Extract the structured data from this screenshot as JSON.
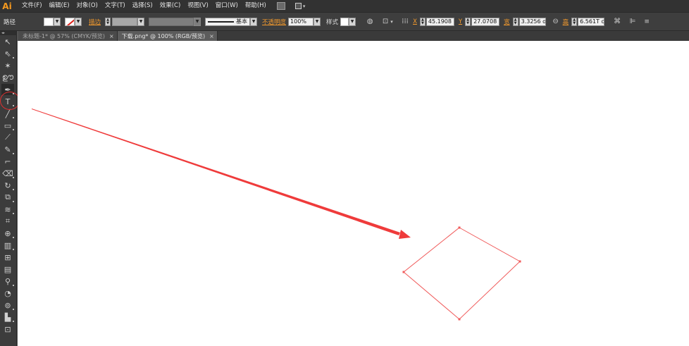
{
  "app": {
    "logo_text": "Ai"
  },
  "menu": {
    "items": [
      "文件(F)",
      "编辑(E)",
      "对象(O)",
      "文字(T)",
      "选择(S)",
      "效果(C)",
      "视图(V)",
      "窗口(W)",
      "帮助(H)"
    ]
  },
  "control_bar": {
    "object_type": "路径",
    "stroke_label": "描边",
    "brush_label": "基本",
    "opacity_label": "不透明度",
    "opacity_value": "100%",
    "style_label": "样式",
    "x_label": "X",
    "x_value": "45.1908",
    "y_label": "Y",
    "y_value": "27.0708",
    "w_label": "宽",
    "w_value": "3.3256 o",
    "h_label": "高",
    "h_value": "6.561T o",
    "stroke_color": "#e0241c",
    "accent_color": "#f39a2d"
  },
  "tabs": [
    {
      "label": "未标题-1* @ 57% (CMYK/预览)",
      "close": "×"
    },
    {
      "label": "下载.png* @ 100% (RGB/预览)",
      "close": "×"
    }
  ],
  "toolbox": {
    "tools": [
      "selection-tool",
      "direct-selection-tool",
      "magic-wand-tool",
      "lasso-tool",
      "pen-tool",
      "type-tool",
      "line-tool",
      "rectangle-tool",
      "paintbrush-tool",
      "pencil-tool",
      "blob-brush-tool",
      "eraser-tool",
      "rotate-tool",
      "scale-tool",
      "warp-tool",
      "free-transform-tool",
      "shape-builder-tool",
      "perspective-grid-tool",
      "mesh-tool",
      "gradient-tool",
      "eyedropper-tool",
      "blend-tool",
      "symbol-sprayer-tool",
      "column-graph-tool",
      "artboard-tool"
    ],
    "selected": "pen-tool"
  },
  "canvas": {
    "annotation_color": "#ef3b3b",
    "shape_color": "#f05a5a"
  }
}
